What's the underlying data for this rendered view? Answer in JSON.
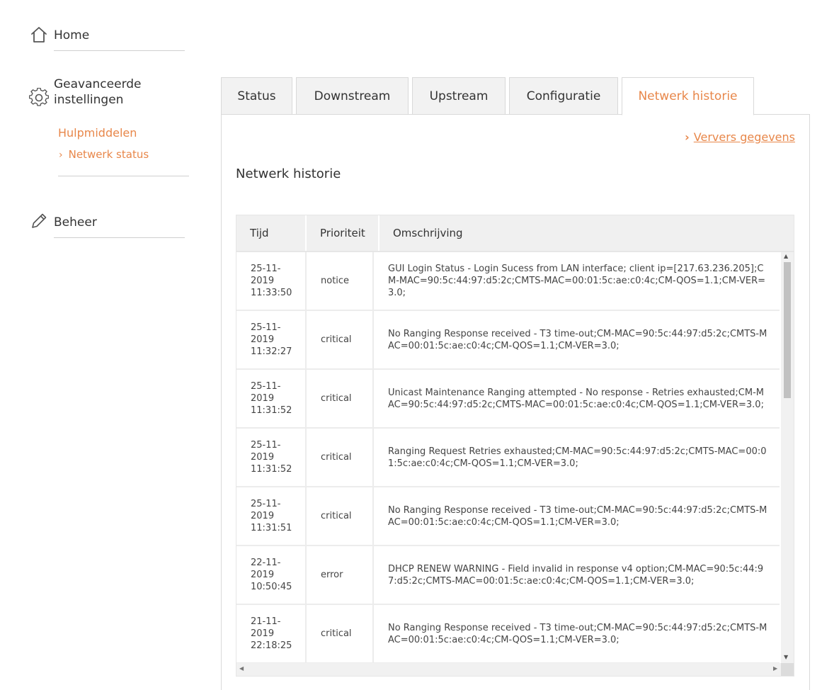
{
  "sidebar": {
    "home": {
      "label": "Home",
      "icon": "home-icon"
    },
    "advanced": {
      "label_line1": "Geavanceerde",
      "label_line2": "instellingen",
      "icon": "gear-icon",
      "section": "Hulpmiddelen",
      "active_link": "Netwerk status"
    },
    "manage": {
      "label": "Beheer",
      "icon": "pencil-icon"
    }
  },
  "tabs": [
    {
      "label": "Status",
      "active": false
    },
    {
      "label": "Downstream",
      "active": false
    },
    {
      "label": "Upstream",
      "active": false
    },
    {
      "label": "Configuratie",
      "active": false
    },
    {
      "label": "Netwerk historie",
      "active": true
    }
  ],
  "panel": {
    "refresh_label": "Ververs gegevens",
    "title": "Netwerk historie"
  },
  "table": {
    "headers": [
      "Tijd",
      "Prioriteit",
      "Omschrijving"
    ],
    "rows": [
      {
        "time": "25-11-\n2019\n11:33:50",
        "priority": "notice",
        "description": "GUI Login Status - Login Sucess from LAN interface; client ip=[217.63.236.205];CM-MAC=90:5c:44:97:d5:2c;CMTS-MAC=00:01:5c:ae:c0:4c;CM-QOS=1.1;CM-VER=3.0;"
      },
      {
        "time": "25-11-\n2019\n11:32:27",
        "priority": "critical",
        "description": "No Ranging Response received - T3 time-out;CM-MAC=90:5c:44:97:d5:2c;CMTS-MAC=00:01:5c:ae:c0:4c;CM-QOS=1.1;CM-VER=3.0;"
      },
      {
        "time": "25-11-\n2019\n11:31:52",
        "priority": "critical",
        "description": "Unicast Maintenance Ranging attempted - No response - Retries exhausted;CM-MAC=90:5c:44:97:d5:2c;CMTS-MAC=00:01:5c:ae:c0:4c;CM-QOS=1.1;CM-VER=3.0;"
      },
      {
        "time": "25-11-\n2019\n11:31:52",
        "priority": "critical",
        "description": "Ranging Request Retries exhausted;CM-MAC=90:5c:44:97:d5:2c;CMTS-MAC=00:01:5c:ae:c0:4c;CM-QOS=1.1;CM-VER=3.0;"
      },
      {
        "time": "25-11-\n2019\n11:31:51",
        "priority": "critical",
        "description": "No Ranging Response received - T3 time-out;CM-MAC=90:5c:44:97:d5:2c;CMTS-MAC=00:01:5c:ae:c0:4c;CM-QOS=1.1;CM-VER=3.0;"
      },
      {
        "time": "22-11-\n2019\n10:50:45",
        "priority": "error",
        "description": "DHCP RENEW WARNING - Field invalid in response v4 option;CM-MAC=90:5c:44:97:d5:2c;CMTS-MAC=00:01:5c:ae:c0:4c;CM-QOS=1.1;CM-VER=3.0;"
      },
      {
        "time": "21-11-\n2019\n22:18:25",
        "priority": "critical",
        "description": "No Ranging Response received - T3 time-out;CM-MAC=90:5c:44:97:d5:2c;CMTS-MAC=00:01:5c:ae:c0:4c;CM-QOS=1.1;CM-VER=3.0;"
      }
    ]
  },
  "colors": {
    "accent": "#e8874a",
    "tab_bg": "#f2f2f2",
    "border": "#d9d9d9"
  }
}
